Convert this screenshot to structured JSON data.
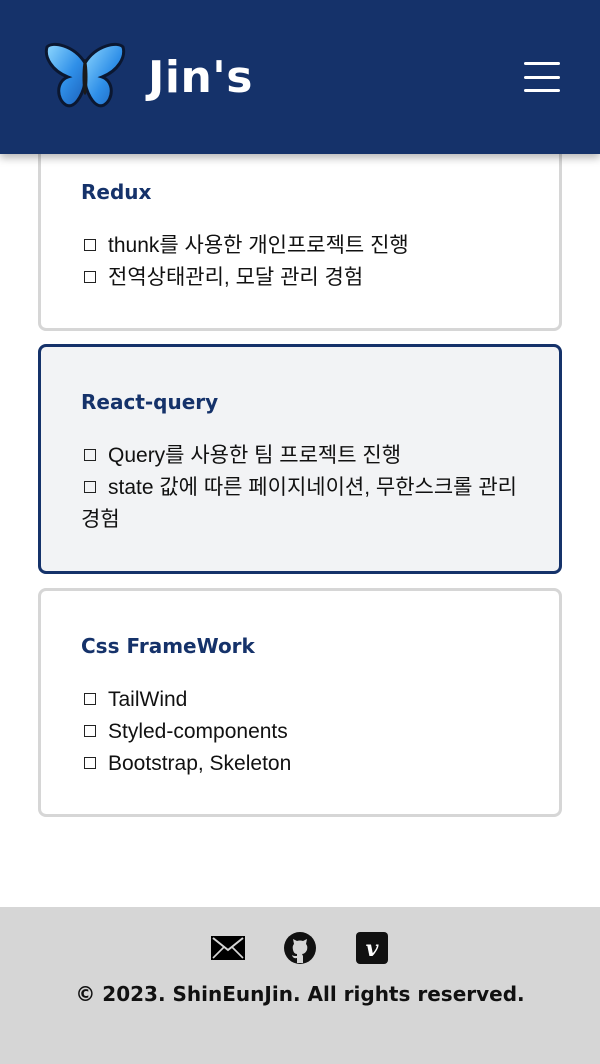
{
  "header": {
    "brand": "Jin's",
    "logo_icon": "butterfly-icon",
    "menu_icon": "hamburger-menu-icon",
    "background": "#15326a"
  },
  "cards": [
    {
      "title": "Redux",
      "items": [
        "thunk를 사용한 개인프로젝트 진행",
        "전역상태관리, 모달 관리 경험"
      ]
    },
    {
      "title": "React-query",
      "items": [
        "Query를 사용한 팀 프로젝트 진행",
        "state 값에 따른 페이지네이션, 무한스크롤 관리 경험"
      ]
    },
    {
      "title": "Css FrameWork",
      "items": [
        "TailWind",
        "Styled-components",
        "Bootstrap, Skeleton"
      ]
    }
  ],
  "footer": {
    "icons": [
      "mail-icon",
      "github-icon",
      "velog-icon"
    ],
    "copyright": "© 2023. ShinEunJin. All rights reserved."
  },
  "colors": {
    "accent": "#15326a",
    "card_border": "#d6d6d6",
    "active_card_bg": "#f2f3f5",
    "footer_bg": "#d6d6d6"
  }
}
